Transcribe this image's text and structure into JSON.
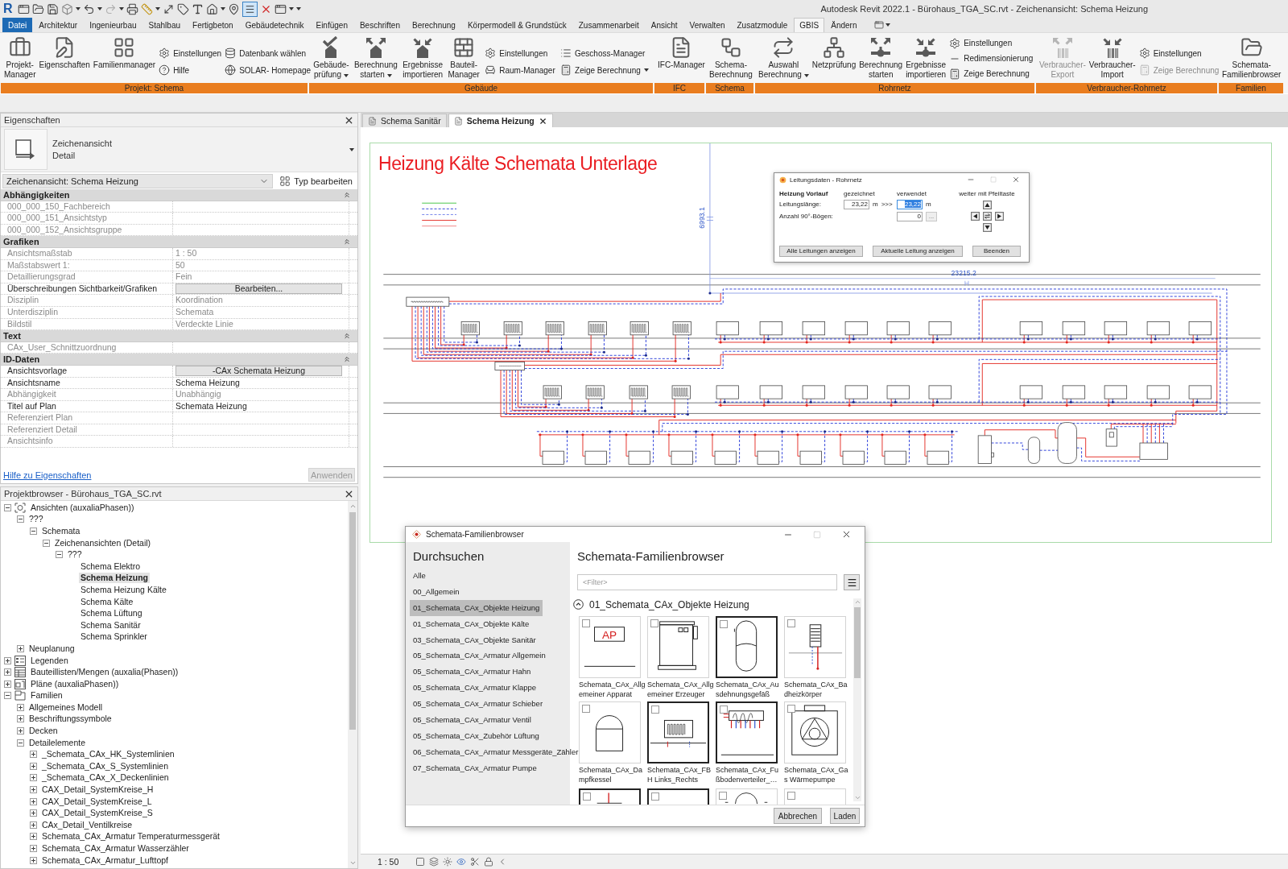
{
  "title_bar": {
    "logo": "R",
    "title": "Autodesk Revit 2022.1 - Bürohaus_TGA_SC.rvt - Zeichenansicht: Schema Heizung",
    "thin_lines_active": true
  },
  "menu_tabs": [
    {
      "label": "Datei",
      "kind": "file",
      "selected": false
    },
    {
      "label": "Architektur",
      "kind": "tab",
      "selected": false
    },
    {
      "label": "Ingenieurbau",
      "kind": "tab",
      "selected": false
    },
    {
      "label": "Stahlbau",
      "kind": "tab",
      "selected": false
    },
    {
      "label": "Fertigbeton",
      "kind": "tab",
      "selected": false
    },
    {
      "label": "Gebäudetechnik",
      "kind": "tab",
      "selected": false
    },
    {
      "label": "Einfügen",
      "kind": "tab",
      "selected": false
    },
    {
      "label": "Beschriften",
      "kind": "tab",
      "selected": false
    },
    {
      "label": "Berechnung",
      "kind": "tab",
      "selected": false
    },
    {
      "label": "Körpermodell & Grundstück",
      "kind": "tab",
      "selected": false
    },
    {
      "label": "Zusammenarbeit",
      "kind": "tab",
      "selected": false
    },
    {
      "label": "Ansicht",
      "kind": "tab",
      "selected": false
    },
    {
      "label": "Verwalten",
      "kind": "tab",
      "selected": false
    },
    {
      "label": "Zusatzmodule",
      "kind": "tab",
      "selected": false
    },
    {
      "label": "GBIS",
      "kind": "tab",
      "selected": true
    },
    {
      "label": "Ändern",
      "kind": "tab",
      "selected": false
    }
  ],
  "ribbon": {
    "panels": [
      {
        "title": "Projekt: Schema",
        "tools": [
          {
            "kind": "large",
            "label": "Projekt-\nManager",
            "dropdown": false,
            "disabled": false
          },
          {
            "kind": "large",
            "label": "Eigenschaften",
            "dropdown": false,
            "disabled": false
          },
          {
            "kind": "large",
            "label": "Familienmanager",
            "dropdown": false,
            "disabled": false
          },
          {
            "kind": "stack",
            "items": [
              {
                "label": "Einstellungen",
                "dropdown": false,
                "disabled": false
              },
              {
                "label": "Hilfe",
                "dropdown": false,
                "disabled": false
              }
            ]
          },
          {
            "kind": "stack",
            "items": [
              {
                "label": "Datenbank wählen",
                "dropdown": false,
                "disabled": false
              },
              {
                "label": "SOLAR- Homepage",
                "dropdown": false,
                "disabled": false
              }
            ]
          }
        ]
      },
      {
        "title": "Gebäude",
        "tools": [
          {
            "kind": "large",
            "label": "Gebäude-\nprüfung",
            "dropdown": true,
            "disabled": false
          },
          {
            "kind": "large",
            "label": "Berechnung\nstarten",
            "dropdown": true,
            "disabled": false
          },
          {
            "kind": "large",
            "label": "Ergebnisse\nimportieren",
            "dropdown": false,
            "disabled": false
          },
          {
            "kind": "large",
            "label": "Bauteil-\nManager",
            "dropdown": false,
            "disabled": false
          },
          {
            "kind": "stack",
            "items": [
              {
                "label": "Einstellungen",
                "dropdown": false,
                "disabled": false
              },
              {
                "label": "Raum-Manager",
                "dropdown": false,
                "disabled": false
              }
            ]
          },
          {
            "kind": "stack",
            "items": [
              {
                "label": "Geschoss-Manager",
                "dropdown": false,
                "disabled": false
              },
              {
                "label": "Zeige Berechnung",
                "dropdown": true,
                "disabled": false
              }
            ]
          }
        ]
      },
      {
        "title": "IFC",
        "tools": [
          {
            "kind": "large",
            "label": "IFC-Manager",
            "dropdown": false,
            "disabled": false
          }
        ]
      },
      {
        "title": "Schema",
        "tools": [
          {
            "kind": "large",
            "label": "Schema-\nBerechnung",
            "dropdown": false,
            "disabled": false
          }
        ]
      },
      {
        "title": "Rohrnetz",
        "tools": [
          {
            "kind": "large",
            "label": "Auswahl\nBerechnung",
            "dropdown": true,
            "disabled": false
          },
          {
            "kind": "large",
            "label": "Netzprüfung",
            "dropdown": false,
            "disabled": false
          },
          {
            "kind": "large",
            "label": "Berechnung\nstarten",
            "dropdown": false,
            "disabled": false
          },
          {
            "kind": "large",
            "label": "Ergebnisse\nimportieren",
            "dropdown": false,
            "disabled": false
          },
          {
            "kind": "stack",
            "items": [
              {
                "label": "Einstellungen",
                "dropdown": false,
                "disabled": false
              },
              {
                "label": "Redimensionierung",
                "dropdown": false,
                "disabled": false
              },
              {
                "label": "Zeige Berechnung",
                "dropdown": false,
                "disabled": false
              }
            ]
          }
        ]
      },
      {
        "title": "Verbraucher-Rohrnetz",
        "tools": [
          {
            "kind": "large",
            "label": "Verbraucher-\nExport",
            "dropdown": false,
            "disabled": true
          },
          {
            "kind": "large",
            "label": "Verbraucher-\nImport",
            "dropdown": false,
            "disabled": false
          },
          {
            "kind": "stack",
            "items": [
              {
                "label": "Einstellungen",
                "dropdown": false,
                "disabled": false
              },
              {
                "label": "Zeige Berechnung",
                "dropdown": false,
                "disabled": true
              }
            ]
          }
        ]
      },
      {
        "title": "Familien",
        "tools": [
          {
            "kind": "large",
            "label": "Schemata-\nFamilienbrowser",
            "dropdown": false,
            "disabled": false
          }
        ]
      }
    ]
  },
  "properties": {
    "title": "Eigenschaften",
    "type_name": "Zeichenansicht",
    "type_detail": "Detail",
    "instance": "Zeichenansicht: Schema Heizung",
    "edit_type": "Typ bearbeiten",
    "groups": [
      {
        "title": "Abhängigkeiten",
        "expanded": true,
        "rows": [
          {
            "label": "000_000_150_Fachbereich",
            "kind": "text",
            "editable": false
          },
          {
            "label": "000_000_151_Ansichtstyp",
            "kind": "text",
            "editable": false
          },
          {
            "label": "000_000_152_Ansichtsgruppe",
            "kind": "text",
            "editable": false
          }
        ]
      },
      {
        "title": "Grafiken",
        "expanded": true,
        "rows": [
          {
            "label": "Ansichtsmaßstab",
            "kind": "text",
            "value": "1 : 50",
            "editable": false
          },
          {
            "label": "Maßstabswert 1:",
            "kind": "text",
            "value": "50",
            "editable": false
          },
          {
            "label": "Detaillierungsgrad",
            "kind": "text",
            "value": "Fein",
            "editable": false
          },
          {
            "label": "Überschreibungen Sichtbarkeit/Grafiken",
            "kind": "button",
            "value": "Bearbeiten...",
            "editable": true
          },
          {
            "label": "Disziplin",
            "kind": "text",
            "value": "Koordination",
            "editable": false
          },
          {
            "label": "Unterdisziplin",
            "kind": "text",
            "value": "Schemata",
            "editable": false
          },
          {
            "label": "Bildstil",
            "kind": "text",
            "value": "Verdeckte Linie",
            "editable": false
          }
        ]
      },
      {
        "title": "Text",
        "expanded": true,
        "rows": [
          {
            "label": "CAx_User_Schnittzuordnung",
            "kind": "text",
            "editable": false
          }
        ]
      },
      {
        "title": "ID-Daten",
        "expanded": true,
        "rows": [
          {
            "label": "Ansichtsvorlage",
            "kind": "button",
            "value": "-CAx Schemata Heizung",
            "editable": true
          },
          {
            "label": "Ansichtsname",
            "kind": "text",
            "value": "Schema Heizung",
            "editable": true
          },
          {
            "label": "Abhängigkeit",
            "kind": "text",
            "value": "Unabhängig",
            "editable": false
          },
          {
            "label": "Titel auf Plan",
            "kind": "text",
            "value": "Schemata Heizung",
            "editable": true
          },
          {
            "label": "Referenziert Plan",
            "kind": "text",
            "editable": false
          },
          {
            "label": "Referenziert Detail",
            "kind": "text",
            "editable": false
          },
          {
            "label": "Ansichtsinfo",
            "kind": "text",
            "editable": false
          }
        ]
      }
    ],
    "help_link": "Hilfe zu Eigenschaften",
    "apply": {
      "label": "Anwenden",
      "disabled": true
    }
  },
  "browser": {
    "title": "Projektbrowser - Bürohaus_TGA_SC.rvt",
    "tree": [
      {
        "label": "Ansichten (auxaliaPhasen))",
        "kind": "views",
        "expanded": true,
        "selected": false,
        "children": [
          {
            "label": "???",
            "expanded": true,
            "selected": false,
            "children": [
              {
                "label": "Schemata",
                "expanded": true,
                "selected": false,
                "children": [
                  {
                    "label": "Zeichenansichten (Detail)",
                    "expanded": true,
                    "selected": false,
                    "children": [
                      {
                        "label": "???",
                        "expanded": true,
                        "selected": false,
                        "children": [
                          {
                            "label": "Schema Elektro",
                            "selected": false
                          },
                          {
                            "label": "Schema Heizung",
                            "selected": true
                          },
                          {
                            "label": "Schema Heizung Kälte",
                            "selected": false
                          },
                          {
                            "label": "Schema Kälte",
                            "selected": false
                          },
                          {
                            "label": "Schema Lüftung",
                            "selected": false
                          },
                          {
                            "label": "Schema Sanitär",
                            "selected": false
                          },
                          {
                            "label": "Schema Sprinkler",
                            "selected": false
                          }
                        ]
                      }
                    ]
                  }
                ]
              }
            ]
          },
          {
            "label": "Neuplanung",
            "expanded": false,
            "selected": false
          }
        ]
      },
      {
        "label": "Legenden",
        "kind": "legends",
        "expanded": false,
        "selected": false
      },
      {
        "label": "Bauteillisten/Mengen (auxalia(Phasen))",
        "kind": "schedules",
        "expanded": false,
        "selected": false
      },
      {
        "label": "Pläne (auxaliaPhasen))",
        "kind": "sheets",
        "expanded": false,
        "selected": false
      },
      {
        "label": "Familien",
        "kind": "families",
        "expanded": true,
        "selected": false,
        "children": [
          {
            "label": "Allgemeines Modell",
            "expanded": false,
            "selected": false
          },
          {
            "label": "Beschriftungssymbole",
            "expanded": false,
            "selected": false
          },
          {
            "label": "Decken",
            "expanded": false,
            "selected": false
          },
          {
            "label": "Detailelemente",
            "expanded": true,
            "selected": false,
            "children": [
              {
                "label": "_Schemata_CAx_HK_Systemlinien",
                "expanded": false,
                "selected": false
              },
              {
                "label": "_Schemata_CAx_S_Systemlinien",
                "expanded": false,
                "selected": false
              },
              {
                "label": "_Schemata_CAx_X_Deckenlinien",
                "expanded": false,
                "selected": false
              },
              {
                "label": "CAX_Detail_SystemKreise_H",
                "expanded": false,
                "selected": false
              },
              {
                "label": "CAX_Detail_SystemKreise_L",
                "expanded": false,
                "selected": false
              },
              {
                "label": "CAX_Detail_SystemKreise_S",
                "expanded": false,
                "selected": false
              },
              {
                "label": "CAx_Detail_Ventilkreise",
                "expanded": false,
                "selected": false
              },
              {
                "label": "Schemata_CAx_Armatur Temperaturmessgerät",
                "expanded": false,
                "selected": false
              },
              {
                "label": "Schemata_CAx_Armatur Wasserzähler",
                "expanded": false,
                "selected": false
              },
              {
                "label": "Schemata_CAx_Armatur_Lufttopf",
                "expanded": false,
                "selected": false
              }
            ]
          }
        ]
      }
    ]
  },
  "view_tabs": [
    {
      "label": "Schema Sanitär",
      "selected": false
    },
    {
      "label": "Schema Heizung",
      "selected": true
    }
  ],
  "canvas": {
    "title": "Heizung Kälte Schemata Unterlage",
    "dimension_vertical": "6993.1",
    "dimension_horizontal": "23215.2"
  },
  "pipe_dialog": {
    "title": "Leitungsdaten - Rohrnetz",
    "pipe": "Heizung Vorlauf",
    "col_drawn": "gezeichnet",
    "col_used": "verwendet",
    "hint": "weiter mit Pfeiltaste",
    "length_label": "Leitungslänge:",
    "length_drawn": "23,22",
    "unit_drawn": "m",
    "transfer": ">>>",
    "length_used": "23,22",
    "length_used_selected": true,
    "unit_used": "m",
    "bends_label": "Anzahl 90°-Bögen:",
    "bends": "0",
    "bends_button": "...",
    "buttons": [
      "Alle Leitungen anzeigen",
      "Aktuelle Leitung anzeigen",
      "Beenden"
    ]
  },
  "family_dialog": {
    "title": "Schemata-Familienbrowser",
    "browse_title": "Durchsuchen",
    "categories": [
      {
        "label": "Alle",
        "selected": false
      },
      {
        "label": "00_Allgemein",
        "selected": false
      },
      {
        "label": "01_Schemata_CAx_Objekte Heizung",
        "selected": true
      },
      {
        "label": "01_Schemata_CAx_Objekte Kälte",
        "selected": false
      },
      {
        "label": "03_Schemata_CAx_Objekte Sanitär",
        "selected": false
      },
      {
        "label": "05_Schemata_CAx_Armatur Allgemein",
        "selected": false
      },
      {
        "label": "05_Schemata_CAx_Armatur Hahn",
        "selected": false
      },
      {
        "label": "05_Schemata_CAx_Armatur Klappe",
        "selected": false
      },
      {
        "label": "05_Schemata_CAx_Armatur Schieber",
        "selected": false
      },
      {
        "label": "05_Schemata_CAx_Armatur Ventil",
        "selected": false
      },
      {
        "label": "05_Schemata_CAx_Zubehör Lüftung",
        "selected": false
      },
      {
        "label": "06_Schemata_CAx_Armatur Messgeräte_Zähler",
        "selected": false
      },
      {
        "label": "07_Schemata_CAx_Armatur Pumpe",
        "selected": false
      }
    ],
    "heading": "Schemata-Familienbrowser",
    "filter": {
      "placeholder": "<Filter>"
    },
    "section": {
      "title": "01_Schemata_CAx_Objekte Heizung",
      "expanded": true
    },
    "tiles": [
      {
        "name": "Schemata_CAx_Allgemeiner Apparat",
        "kind": "apparatus",
        "preview_text": "AP",
        "checked": false,
        "selected": false
      },
      {
        "name": "Schemata_CAx_Allgemeiner Erzeuger",
        "kind": "generator",
        "checked": false,
        "selected": false
      },
      {
        "name": "Schemata_CAx_Ausdehnungsgefäß",
        "kind": "expansion_vessel",
        "checked": false,
        "selected": true
      },
      {
        "name": "Schemata_CAx_Badheizkörper",
        "kind": "bath_radiator",
        "checked": false,
        "selected": false
      },
      {
        "name": "Schemata_CAx_Dampfkessel",
        "kind": "steam_boiler",
        "checked": false,
        "selected": false
      },
      {
        "name": "Schemata_CAx_FBH Links_Rechts",
        "kind": "floor_heating",
        "checked": false,
        "selected": true
      },
      {
        "name": "Schemata_CAx_Fußbodenverteiler_…",
        "kind": "manifold",
        "checked": false,
        "selected": true
      },
      {
        "name": "Schemata_CAx_Gas Wärmepumpe",
        "kind": "heat_pump",
        "checked": false,
        "selected": false
      },
      {
        "kind": "valve",
        "checked": false,
        "selected": true
      },
      {
        "kind": "plain",
        "checked": false,
        "selected": true
      },
      {
        "kind": "vessel",
        "checked": false,
        "selected": false
      },
      {
        "kind": "plain",
        "checked": false,
        "selected": false
      }
    ],
    "buttons": [
      "Abbrechen",
      "Laden"
    ]
  },
  "status_bar": {
    "scale": "1 : 50"
  }
}
